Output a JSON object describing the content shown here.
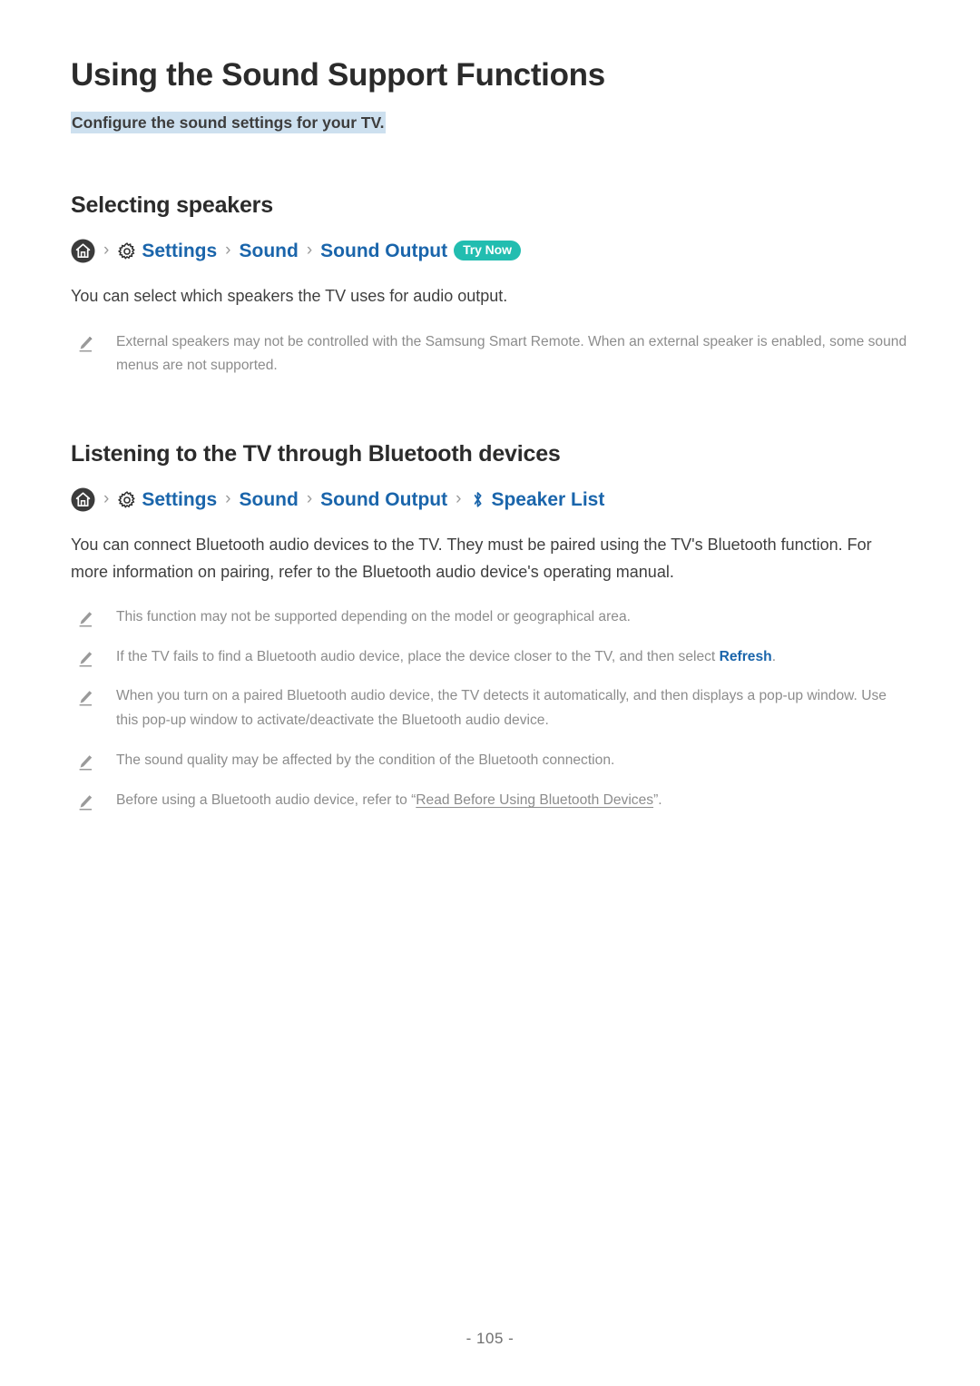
{
  "document": {
    "title": "Using the Sound Support Functions",
    "subtitle": "Configure the sound settings for your TV.",
    "page_number": "- 105 -"
  },
  "colors": {
    "link_blue": "#1a65ab",
    "badge_teal": "#22bdb0",
    "highlight_blue": "#cde0ef",
    "note_gray": "#8c8c8c",
    "heading_dark": "#2b2b2b"
  },
  "sections": [
    {
      "heading": "Selecting speakers",
      "breadcrumb": {
        "home_icon": "home-icon",
        "separator": "›",
        "items": [
          {
            "icon": "gear-icon",
            "label": "Settings"
          },
          {
            "icon": "",
            "label": "Sound"
          },
          {
            "icon": "",
            "label": "Sound Output"
          }
        ],
        "badge": "Try Now"
      },
      "body": "You can select which speakers the TV uses for audio output.",
      "notes": [
        {
          "icon": "pencil-note-icon",
          "text": "External speakers may not be controlled with the Samsung Smart Remote. When an external speaker is enabled, some sound menus are not supported."
        }
      ]
    },
    {
      "heading": "Listening to the TV through Bluetooth devices",
      "breadcrumb": {
        "home_icon": "home-icon",
        "separator": "›",
        "items": [
          {
            "icon": "gear-icon",
            "label": "Settings"
          },
          {
            "icon": "",
            "label": "Sound"
          },
          {
            "icon": "",
            "label": "Sound Output"
          },
          {
            "icon": "bluetooth-icon",
            "label": "Speaker List"
          }
        ],
        "badge": ""
      },
      "body": "You can connect Bluetooth audio devices to the TV. They must be paired using the TV's Bluetooth function. For more information on pairing, refer to the Bluetooth audio device's operating manual.",
      "notes": [
        {
          "icon": "pencil-note-icon",
          "text": "This function may not be supported depending on the model or geographical area."
        },
        {
          "icon": "pencil-note-icon",
          "text_before": "If the TV fails to find a Bluetooth audio device, place the device closer to the TV, and then select ",
          "link": "Refresh",
          "text_after": "."
        },
        {
          "icon": "pencil-note-icon",
          "text": "When you turn on a paired Bluetooth audio device, the TV detects it automatically, and then displays a pop-up window. Use this pop-up window to activate/deactivate the Bluetooth audio device."
        },
        {
          "icon": "pencil-note-icon",
          "text": "The sound quality may be affected by the condition of the Bluetooth connection."
        },
        {
          "icon": "pencil-note-icon",
          "text_before": "Before using a Bluetooth audio device, refer to “",
          "underlined": "Read Before Using Bluetooth Devices",
          "text_after": "”."
        }
      ]
    }
  ]
}
